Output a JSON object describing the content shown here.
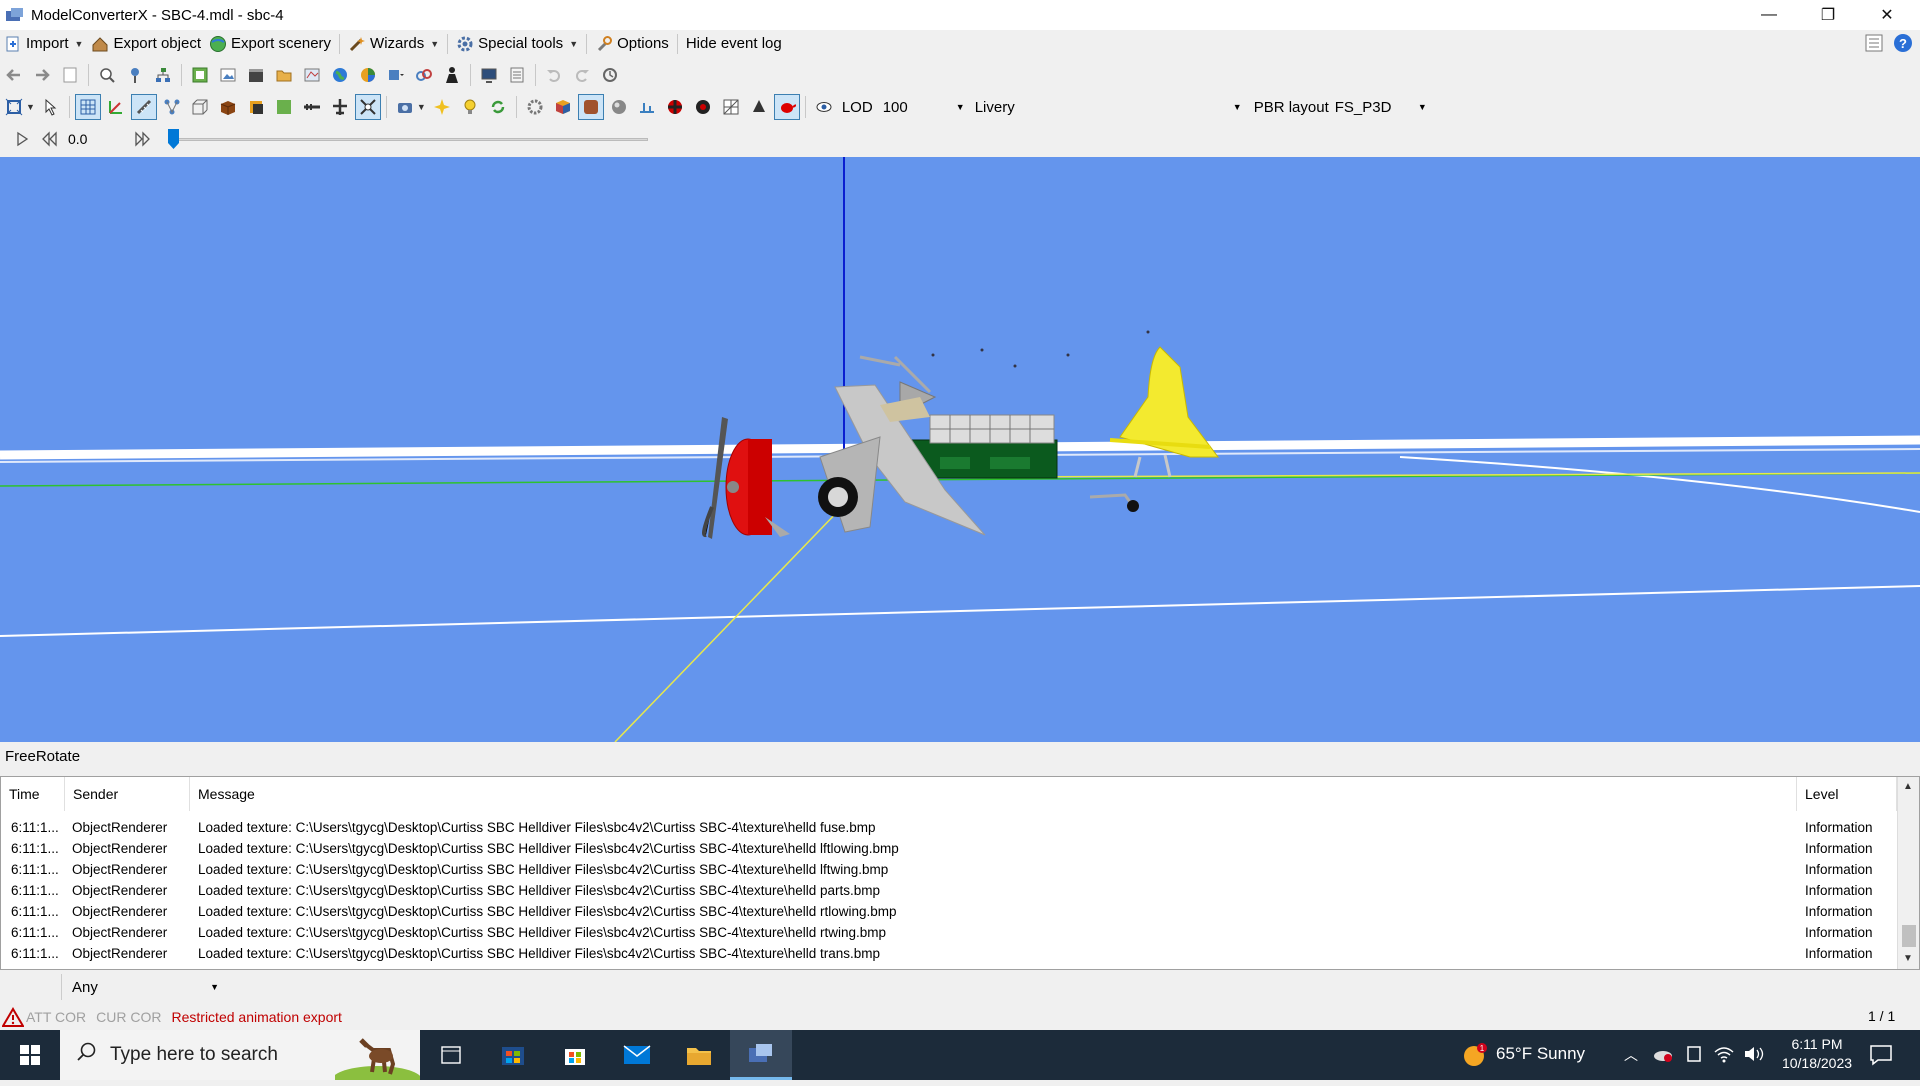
{
  "window": {
    "title": "ModelConverterX - SBC-4.mdl - sbc-4",
    "minimize": "—",
    "restore": "❐",
    "close": "✕"
  },
  "menu": {
    "import": "Import",
    "export_object": "Export object",
    "export_scenery": "Export scenery",
    "wizards": "Wizards",
    "special_tools": "Special tools",
    "options": "Options",
    "hide_event_log": "Hide event log"
  },
  "render_toolbar": {
    "lod_label": "LOD",
    "lod_value": "100",
    "livery_label": "Livery",
    "livery_value": "",
    "pbr_label": "PBR layout",
    "pbr_value": "FS_P3D"
  },
  "animation": {
    "time_value": "0.0",
    "slider_position": 0.0
  },
  "viewport": {
    "mode_label": "FreeRotate",
    "background_color": "#6495ed"
  },
  "event_log": {
    "columns": {
      "time": "Time",
      "sender": "Sender",
      "message": "Message",
      "level": "Level"
    },
    "rows": [
      {
        "time": "6:11:1...",
        "sender": "ObjectRenderer",
        "message": "Loaded texture: C:\\Users\\tgycg\\Desktop\\Curtiss SBC Helldiver Files\\sbc4v2\\Curtiss SBC-4\\texture\\helld fuse.bmp",
        "level": "Information"
      },
      {
        "time": "6:11:1...",
        "sender": "ObjectRenderer",
        "message": "Loaded texture: C:\\Users\\tgycg\\Desktop\\Curtiss SBC Helldiver Files\\sbc4v2\\Curtiss SBC-4\\texture\\helld lftlowing.bmp",
        "level": "Information"
      },
      {
        "time": "6:11:1...",
        "sender": "ObjectRenderer",
        "message": "Loaded texture: C:\\Users\\tgycg\\Desktop\\Curtiss SBC Helldiver Files\\sbc4v2\\Curtiss SBC-4\\texture\\helld lftwing.bmp",
        "level": "Information"
      },
      {
        "time": "6:11:1...",
        "sender": "ObjectRenderer",
        "message": "Loaded texture: C:\\Users\\tgycg\\Desktop\\Curtiss SBC Helldiver Files\\sbc4v2\\Curtiss SBC-4\\texture\\helld parts.bmp",
        "level": "Information"
      },
      {
        "time": "6:11:1...",
        "sender": "ObjectRenderer",
        "message": "Loaded texture: C:\\Users\\tgycg\\Desktop\\Curtiss SBC Helldiver Files\\sbc4v2\\Curtiss SBC-4\\texture\\helld rtlowing.bmp",
        "level": "Information"
      },
      {
        "time": "6:11:1...",
        "sender": "ObjectRenderer",
        "message": "Loaded texture: C:\\Users\\tgycg\\Desktop\\Curtiss SBC Helldiver Files\\sbc4v2\\Curtiss SBC-4\\texture\\helld rtwing.bmp",
        "level": "Information"
      },
      {
        "time": "6:11:1...",
        "sender": "ObjectRenderer",
        "message": "Loaded texture: C:\\Users\\tgycg\\Desktop\\Curtiss SBC Helldiver Files\\sbc4v2\\Curtiss SBC-4\\texture\\helld trans.bmp",
        "level": "Information"
      }
    ],
    "filter_value": "Any"
  },
  "statusbar": {
    "att_cor": "ATT COR",
    "cur_cor": "CUR COR",
    "warning": "Restricted animation export",
    "page": "1 / 1"
  },
  "taskbar": {
    "search_placeholder": "Type here to search",
    "weather": "65°F  Sunny",
    "time": "6:11 PM",
    "date": "10/18/2023"
  },
  "colors": {
    "accent": "#0078d7",
    "warning_red": "#c00000",
    "viewport_blue": "#6495ed",
    "taskbar": "#1c2b3a"
  }
}
